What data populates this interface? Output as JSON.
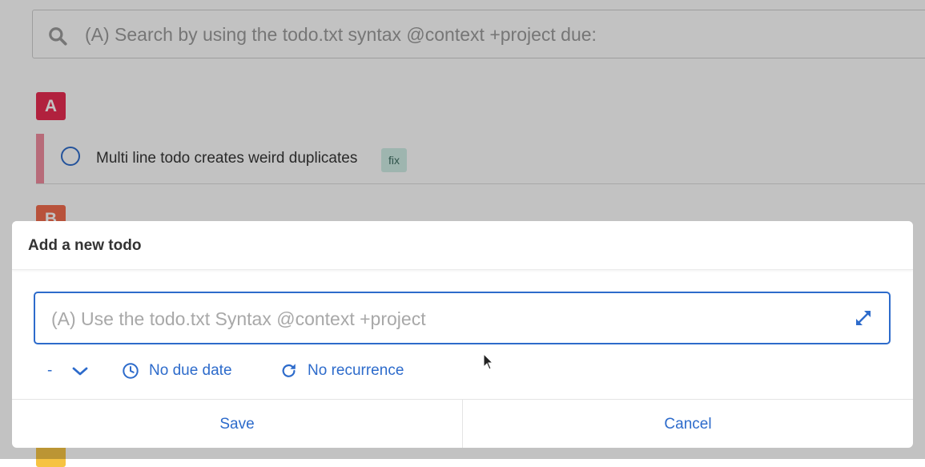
{
  "search": {
    "placeholder": "(A) Search by using the todo.txt syntax @context +project due:"
  },
  "priorities": {
    "a": "A",
    "b": "B",
    "c": ""
  },
  "todos": [
    {
      "text": "Multi line todo creates weird duplicates",
      "tag": "fix"
    }
  ],
  "modal": {
    "title": "Add a new todo",
    "input_placeholder": "(A) Use the todo.txt Syntax @context +project",
    "input_value": "",
    "priority_value": "-",
    "due_label": "No due date",
    "recurrence_label": "No recurrence",
    "save_label": "Save",
    "cancel_label": "Cancel"
  },
  "icons": {
    "search": "search-icon",
    "expand": "expand-icon",
    "chevron": "chevron-down-icon",
    "clock": "clock-icon",
    "recurrence": "redo-icon"
  },
  "colors": {
    "accent": "#2d6bcb",
    "priority_a": "#e8284f",
    "priority_b": "#f26a4b",
    "priority_c": "#f6c342",
    "tag_bg": "#cfeee6"
  }
}
